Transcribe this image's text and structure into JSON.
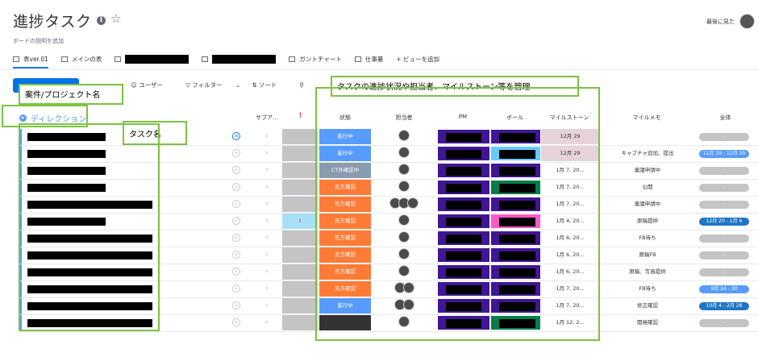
{
  "board": {
    "title": "進捗タスク",
    "description_placeholder": "ボードの説明を追加",
    "last_seen_label": "最後に見た"
  },
  "tabs": [
    {
      "label": "表ver.01",
      "active": true
    },
    {
      "label": "メインの表"
    },
    {
      "label": ""
    },
    {
      "label": ""
    },
    {
      "label": "ガントチャート"
    },
    {
      "label": "仕事量"
    },
    {
      "label": "+ ビューを追加"
    }
  ],
  "toolbar": {
    "person_label": "ユーザー",
    "filter_label": "フィルター",
    "sort_label": "ソート"
  },
  "group": {
    "title": "ディレクション",
    "color": "#579bfc"
  },
  "columns": {
    "subitems": "サブア…",
    "priority": "!",
    "status": "状態",
    "owner": "担当者",
    "pm": "PM",
    "ball": "ボール",
    "milestone": "マイルストーン",
    "memo": "マイルメモ",
    "timeline": "全体"
  },
  "callouts": {
    "project_name": "案件/プロジェクト名",
    "task_name": "タスク名",
    "columns_note": "タスクの進捗状況や担当者、マイルストーン等を管理"
  },
  "colors": {
    "status_blue": "#579bfc",
    "status_gray": "#c4c4c4",
    "status_orange": "#fd7b37",
    "pm_purple": "#401694",
    "accent": "#0073ea",
    "callout_border": "#7dc242"
  },
  "rows": [
    {
      "status": "進行中",
      "status_color": "#579bfc",
      "milestone": "12月 29",
      "milestone_bg": "#e6d3d8",
      "memo": "",
      "timeline": "-",
      "timeline_color": "#c4c4c4",
      "ball_color": "#401694",
      "subicon": "blue",
      "priority_bg": "#c4c4c4",
      "owners": 1
    },
    {
      "status": "進行中",
      "status_color": "#579bfc",
      "milestone": "12月 29",
      "milestone_bg": "#e6d3d8",
      "memo": "キャプチャ追加、提出",
      "timeline": "11月 29 - 12月 29",
      "timeline_color": "#579bfc",
      "ball_color": "#66ccff",
      "subicon": "gray",
      "priority_bg": "#c4c4c4",
      "owners": 1
    },
    {
      "status": "CT外確認中",
      "status_color": "#8a9bb0",
      "milestone": "1月 7, 20...",
      "milestone_bg": "#fff",
      "memo": "稟議申請中",
      "timeline": "-",
      "timeline_color": "#c4c4c4",
      "ball_color": "#401694",
      "subicon": "",
      "priority_bg": "#c4c4c4",
      "owners": 1
    },
    {
      "status": "先方確認",
      "status_color": "#fd7b37",
      "milestone": "1月 7, 20...",
      "milestone_bg": "#fff",
      "memo": "公開",
      "timeline": "-",
      "timeline_color": "#c4c4c4",
      "ball_color": "#037f4c",
      "subicon": "",
      "priority_bg": "#c4c4c4",
      "owners": 1
    },
    {
      "status": "先方確認",
      "status_color": "#fd7b37",
      "milestone": "1月 7, 20...",
      "milestone_bg": "#fff",
      "memo": "稟議申請中",
      "timeline": "-",
      "timeline_color": "#c4c4c4",
      "ball_color": "#401694",
      "subicon": "",
      "priority_bg": "#c4c4c4",
      "owners": 3
    },
    {
      "status": "先方確認",
      "status_color": "#fd7b37",
      "milestone": "1月 4, 20...",
      "milestone_bg": "#fff",
      "memo": "原稿提供",
      "timeline": "12月 20 - 1月 6",
      "timeline_color": "#1f76c2",
      "ball_color": "#ff5ac4",
      "subicon": "",
      "priority_bg": "#a6e0f7",
      "priority_mark": "!",
      "owners": 1
    },
    {
      "status": "先方確認",
      "status_color": "#fd7b37",
      "milestone": "1月 6, 20...",
      "milestone_bg": "#fff",
      "memo": "FB待ち",
      "timeline": "-",
      "timeline_color": "#c4c4c4",
      "ball_color": "#401694",
      "subicon": "",
      "priority_bg": "#c4c4c4",
      "owners": 1
    },
    {
      "status": "先方確認",
      "status_color": "#fd7b37",
      "milestone": "1月 6, 20...",
      "milestone_bg": "#fff",
      "memo": "原稿FB",
      "timeline": "-",
      "timeline_color": "#c4c4c4",
      "ball_color": "#401694",
      "subicon": "",
      "priority_bg": "#c4c4c4",
      "owners": 1
    },
    {
      "status": "先方確認",
      "status_color": "#fd7b37",
      "milestone": "1月 6, 20...",
      "milestone_bg": "#fff",
      "memo": "原稿、写真提供",
      "timeline": "-",
      "timeline_color": "#c4c4c4",
      "ball_color": "#401694",
      "subicon": "",
      "priority_bg": "#c4c4c4",
      "owners": 1
    },
    {
      "status": "先方確認",
      "status_color": "#fd7b37",
      "milestone": "1月 7, 20...",
      "milestone_bg": "#fff",
      "memo": "FB待ち",
      "timeline": "9月 24 - 30",
      "timeline_color": "#579bfc",
      "ball_color": "#401694",
      "subicon": "",
      "priority_bg": "#c4c4c4",
      "owners": 2
    },
    {
      "status": "進行中",
      "status_color": "#579bfc",
      "milestone": "1月 7, 20...",
      "milestone_bg": "#fff",
      "memo": "修正確認",
      "timeline": "10月 4 - 2月 28",
      "timeline_color": "#1f76c2",
      "ball_color": "#401694",
      "subicon": "",
      "priority_bg": "#c4c4c4",
      "owners": 2
    },
    {
      "status": "",
      "status_color": "#333333",
      "milestone": "1月 12, 2...",
      "milestone_bg": "#fff",
      "memo": "開発確認",
      "timeline": "-",
      "timeline_color": "#c4c4c4",
      "ball_color": "#037f4c",
      "subicon": "",
      "priority_bg": "#c4c4c4",
      "owners": 1
    }
  ]
}
